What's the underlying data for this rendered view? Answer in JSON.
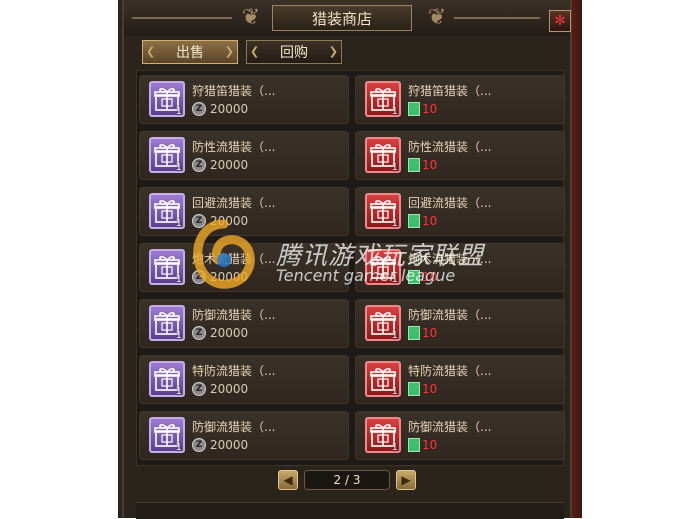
{
  "window": {
    "title": "猎装商店",
    "close_icon": "close-icon"
  },
  "tabs": [
    {
      "label": "出售",
      "active": true
    },
    {
      "label": "回购",
      "active": false
    }
  ],
  "items": [
    {
      "name": "狩猎笛猎装（...",
      "qty": "1",
      "color": "purple",
      "currency": "coin",
      "price": "20000"
    },
    {
      "name": "狩猎笛猎装（...",
      "qty": "1",
      "color": "red",
      "currency": "ticket",
      "price": "10"
    },
    {
      "name": "防性流猎装（...",
      "qty": "1",
      "color": "purple",
      "currency": "coin",
      "price": "20000"
    },
    {
      "name": "防性流猎装（...",
      "qty": "1",
      "color": "red",
      "currency": "ticket",
      "price": "10"
    },
    {
      "name": "回避流猎装（...",
      "qty": "1",
      "color": "purple",
      "currency": "coin",
      "price": "20000"
    },
    {
      "name": "回避流猎装（...",
      "qty": "1",
      "color": "red",
      "currency": "ticket",
      "price": "10"
    },
    {
      "name": "炮术流猎装（...",
      "qty": "1",
      "color": "purple",
      "currency": "coin",
      "price": "20000"
    },
    {
      "name": "炮术流猎装（...",
      "qty": "1",
      "color": "red",
      "currency": "ticket",
      "price": "10"
    },
    {
      "name": "防御流猎装（...",
      "qty": "1",
      "color": "purple",
      "currency": "coin",
      "price": "20000"
    },
    {
      "name": "防御流猎装（...",
      "qty": "1",
      "color": "red",
      "currency": "ticket",
      "price": "10"
    },
    {
      "name": "特防流猎装（...",
      "qty": "1",
      "color": "purple",
      "currency": "coin",
      "price": "20000"
    },
    {
      "name": "特防流猎装（...",
      "qty": "1",
      "color": "red",
      "currency": "ticket",
      "price": "10"
    },
    {
      "name": "防御流猎装（...",
      "qty": "1",
      "color": "purple",
      "currency": "coin",
      "price": "20000"
    },
    {
      "name": "防御流猎装（...",
      "qty": "1",
      "color": "red",
      "currency": "ticket",
      "price": "10"
    }
  ],
  "pager": {
    "text": "2 / 3",
    "prev_icon": "chevron-left-icon",
    "next_icon": "chevron-right-icon"
  },
  "watermark": {
    "cn": "腾讯游戏玩家联盟",
    "en": "Tencent gamer league"
  },
  "colors": {
    "panel_bg": "#2b241d",
    "purple_item": "#7a5bb0",
    "red_item": "#c22a2a",
    "price_red": "#ff3434",
    "title_text": "#f0e2c4"
  }
}
